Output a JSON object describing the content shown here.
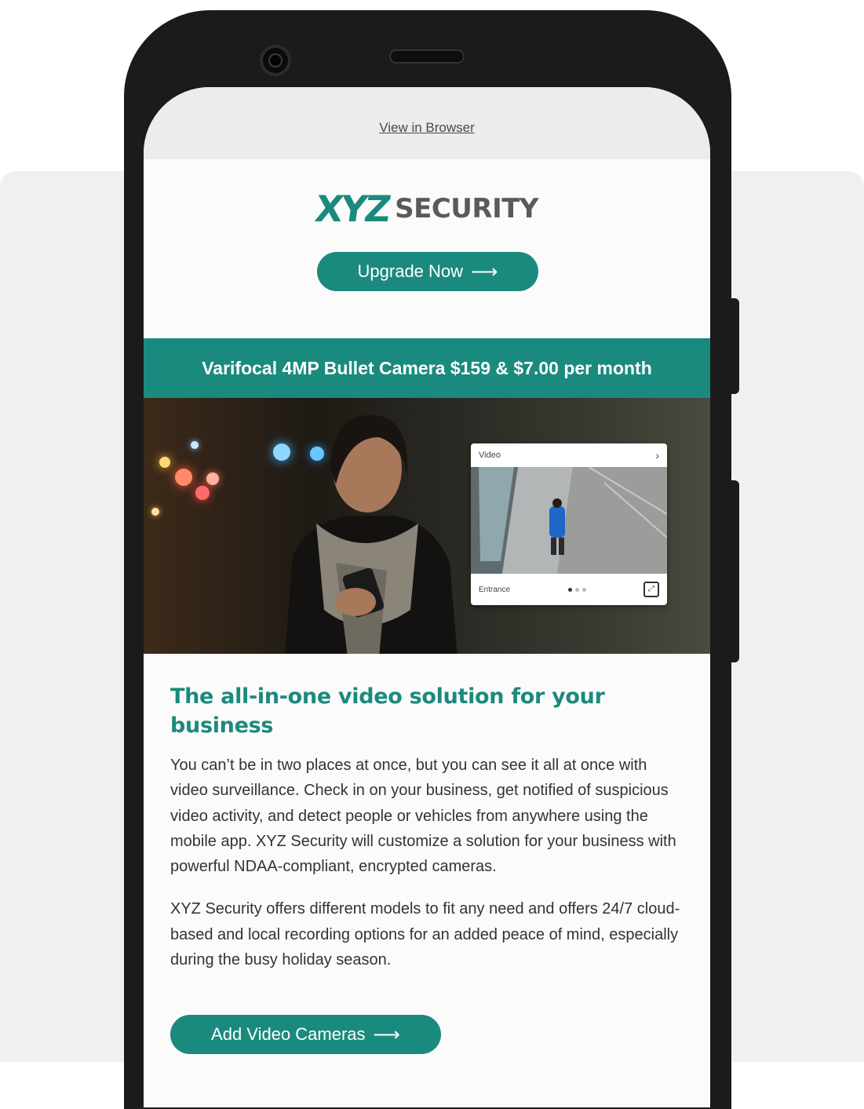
{
  "email": {
    "view_in_browser": "View in Browser",
    "logo": {
      "mark": "XYZ",
      "word": "SECURITY"
    },
    "upgrade_button": "Upgrade Now",
    "banner": "Varifocal 4MP Bullet Camera $159 & $7.00 per month",
    "video_card": {
      "title": "Video",
      "camera_name": "Entrance"
    },
    "headline": "The all-in-one video solution for your business",
    "paragraph_1": "You can’t be in two places at once, but you can see it all at once with video surveillance. Check in on your business, get notified of suspicious video activity, and detect people or vehicles from anywhere using the mobile app. XYZ Security will customize a solution for your business with powerful NDAA-compliant, encrypted cameras.",
    "paragraph_2": "XYZ Security offers different models to fit any need and offers 24/7 cloud-based and local recording options for an added peace of mind, especially during the busy holiday season.",
    "add_cameras_button": "Add Video Cameras"
  },
  "colors": {
    "brand": "#1b8a7e",
    "text": "#333333",
    "phone": "#1b1b1b"
  },
  "icons": {
    "arrow": "arrow-right-icon",
    "chevron": "chevron-right-icon",
    "expand": "expand-icon"
  }
}
